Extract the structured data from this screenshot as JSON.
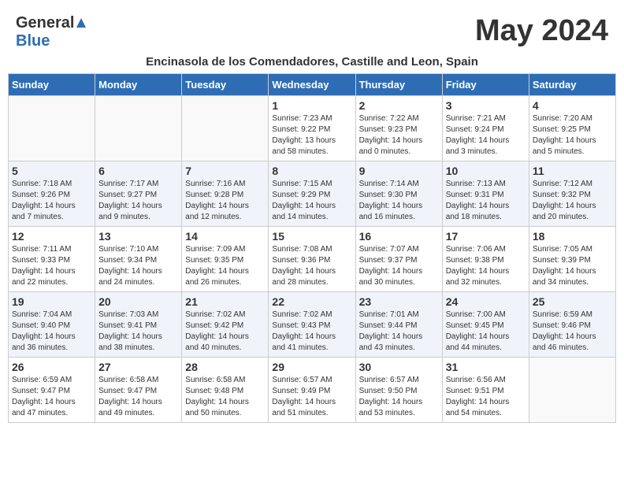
{
  "header": {
    "logo_general": "General",
    "logo_blue": "Blue",
    "month_year": "May 2024",
    "subtitle": "Encinasola de los Comendadores, Castille and Leon, Spain"
  },
  "days_of_week": [
    "Sunday",
    "Monday",
    "Tuesday",
    "Wednesday",
    "Thursday",
    "Friday",
    "Saturday"
  ],
  "weeks": [
    [
      {
        "day": "",
        "info": ""
      },
      {
        "day": "",
        "info": ""
      },
      {
        "day": "",
        "info": ""
      },
      {
        "day": "1",
        "info": "Sunrise: 7:23 AM\nSunset: 9:22 PM\nDaylight: 13 hours\nand 58 minutes."
      },
      {
        "day": "2",
        "info": "Sunrise: 7:22 AM\nSunset: 9:23 PM\nDaylight: 14 hours\nand 0 minutes."
      },
      {
        "day": "3",
        "info": "Sunrise: 7:21 AM\nSunset: 9:24 PM\nDaylight: 14 hours\nand 3 minutes."
      },
      {
        "day": "4",
        "info": "Sunrise: 7:20 AM\nSunset: 9:25 PM\nDaylight: 14 hours\nand 5 minutes."
      }
    ],
    [
      {
        "day": "5",
        "info": "Sunrise: 7:18 AM\nSunset: 9:26 PM\nDaylight: 14 hours\nand 7 minutes."
      },
      {
        "day": "6",
        "info": "Sunrise: 7:17 AM\nSunset: 9:27 PM\nDaylight: 14 hours\nand 9 minutes."
      },
      {
        "day": "7",
        "info": "Sunrise: 7:16 AM\nSunset: 9:28 PM\nDaylight: 14 hours\nand 12 minutes."
      },
      {
        "day": "8",
        "info": "Sunrise: 7:15 AM\nSunset: 9:29 PM\nDaylight: 14 hours\nand 14 minutes."
      },
      {
        "day": "9",
        "info": "Sunrise: 7:14 AM\nSunset: 9:30 PM\nDaylight: 14 hours\nand 16 minutes."
      },
      {
        "day": "10",
        "info": "Sunrise: 7:13 AM\nSunset: 9:31 PM\nDaylight: 14 hours\nand 18 minutes."
      },
      {
        "day": "11",
        "info": "Sunrise: 7:12 AM\nSunset: 9:32 PM\nDaylight: 14 hours\nand 20 minutes."
      }
    ],
    [
      {
        "day": "12",
        "info": "Sunrise: 7:11 AM\nSunset: 9:33 PM\nDaylight: 14 hours\nand 22 minutes."
      },
      {
        "day": "13",
        "info": "Sunrise: 7:10 AM\nSunset: 9:34 PM\nDaylight: 14 hours\nand 24 minutes."
      },
      {
        "day": "14",
        "info": "Sunrise: 7:09 AM\nSunset: 9:35 PM\nDaylight: 14 hours\nand 26 minutes."
      },
      {
        "day": "15",
        "info": "Sunrise: 7:08 AM\nSunset: 9:36 PM\nDaylight: 14 hours\nand 28 minutes."
      },
      {
        "day": "16",
        "info": "Sunrise: 7:07 AM\nSunset: 9:37 PM\nDaylight: 14 hours\nand 30 minutes."
      },
      {
        "day": "17",
        "info": "Sunrise: 7:06 AM\nSunset: 9:38 PM\nDaylight: 14 hours\nand 32 minutes."
      },
      {
        "day": "18",
        "info": "Sunrise: 7:05 AM\nSunset: 9:39 PM\nDaylight: 14 hours\nand 34 minutes."
      }
    ],
    [
      {
        "day": "19",
        "info": "Sunrise: 7:04 AM\nSunset: 9:40 PM\nDaylight: 14 hours\nand 36 minutes."
      },
      {
        "day": "20",
        "info": "Sunrise: 7:03 AM\nSunset: 9:41 PM\nDaylight: 14 hours\nand 38 minutes."
      },
      {
        "day": "21",
        "info": "Sunrise: 7:02 AM\nSunset: 9:42 PM\nDaylight: 14 hours\nand 40 minutes."
      },
      {
        "day": "22",
        "info": "Sunrise: 7:02 AM\nSunset: 9:43 PM\nDaylight: 14 hours\nand 41 minutes."
      },
      {
        "day": "23",
        "info": "Sunrise: 7:01 AM\nSunset: 9:44 PM\nDaylight: 14 hours\nand 43 minutes."
      },
      {
        "day": "24",
        "info": "Sunrise: 7:00 AM\nSunset: 9:45 PM\nDaylight: 14 hours\nand 44 minutes."
      },
      {
        "day": "25",
        "info": "Sunrise: 6:59 AM\nSunset: 9:46 PM\nDaylight: 14 hours\nand 46 minutes."
      }
    ],
    [
      {
        "day": "26",
        "info": "Sunrise: 6:59 AM\nSunset: 9:47 PM\nDaylight: 14 hours\nand 47 minutes."
      },
      {
        "day": "27",
        "info": "Sunrise: 6:58 AM\nSunset: 9:47 PM\nDaylight: 14 hours\nand 49 minutes."
      },
      {
        "day": "28",
        "info": "Sunrise: 6:58 AM\nSunset: 9:48 PM\nDaylight: 14 hours\nand 50 minutes."
      },
      {
        "day": "29",
        "info": "Sunrise: 6:57 AM\nSunset: 9:49 PM\nDaylight: 14 hours\nand 51 minutes."
      },
      {
        "day": "30",
        "info": "Sunrise: 6:57 AM\nSunset: 9:50 PM\nDaylight: 14 hours\nand 53 minutes."
      },
      {
        "day": "31",
        "info": "Sunrise: 6:56 AM\nSunset: 9:51 PM\nDaylight: 14 hours\nand 54 minutes."
      },
      {
        "day": "",
        "info": ""
      }
    ]
  ]
}
